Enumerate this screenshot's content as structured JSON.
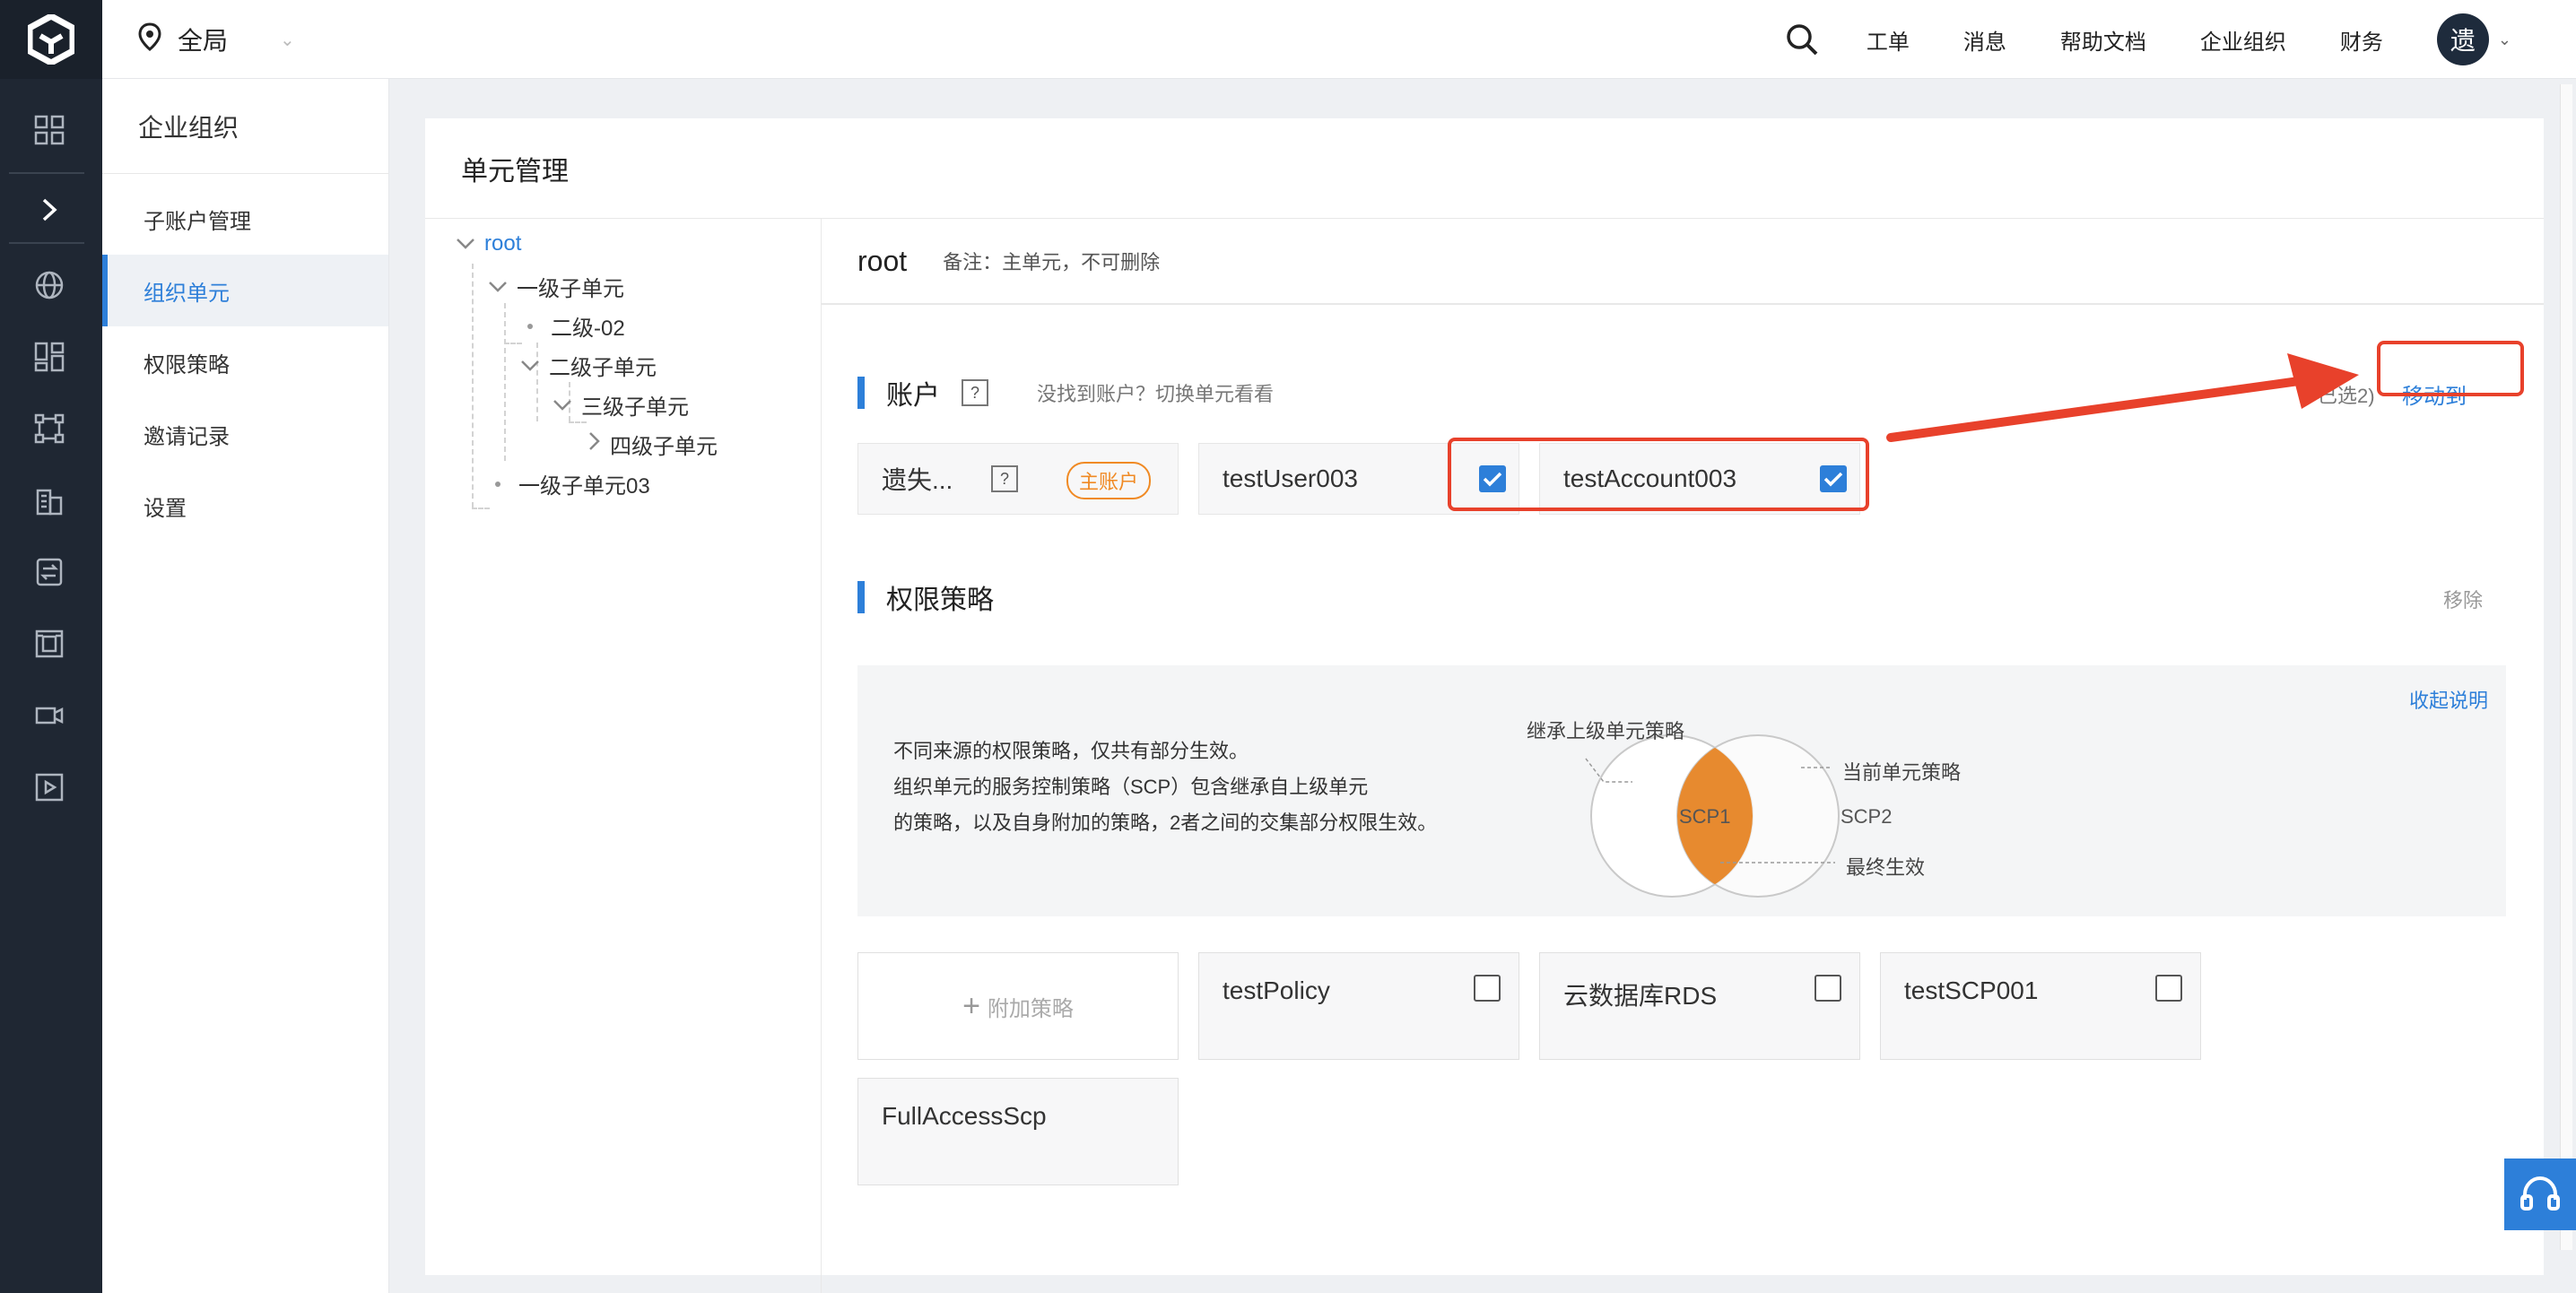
{
  "topbar": {
    "region": "全局",
    "nav": [
      "工单",
      "消息",
      "帮助文档",
      "企业组织",
      "财务"
    ],
    "avatar": "遗"
  },
  "subnav": {
    "title": "企业组织",
    "items": [
      {
        "label": "子账户管理",
        "active": false
      },
      {
        "label": "组织单元",
        "active": true
      },
      {
        "label": "权限策略",
        "active": false
      },
      {
        "label": "邀请记录",
        "active": false
      },
      {
        "label": "设置",
        "active": false
      }
    ]
  },
  "page": {
    "title": "单元管理"
  },
  "tree": {
    "root": "root",
    "l1a": "一级子单元",
    "l2a": "二级-02",
    "l2b": "二级子单元",
    "l3a": "三级子单元",
    "l4a": "四级子单元",
    "l1b": "一级子单元03"
  },
  "unit": {
    "name": "root",
    "note": "备注：主单元，不可删除"
  },
  "accounts": {
    "section_label": "账户",
    "help": "?",
    "hint": "没找到账户？切换单元看看",
    "selected_text": "已选2)",
    "move_to": "移动到",
    "items": [
      {
        "name": "遗失...",
        "badge": "主账户",
        "help": "?"
      },
      {
        "name": "testUser003",
        "checked": true
      },
      {
        "name": "testAccount003",
        "checked": true
      }
    ]
  },
  "policies": {
    "section_label": "权限策略",
    "remove": "移除",
    "collapse": "收起说明",
    "explain_lines": [
      "不同来源的权限策略，仅共有部分生效。",
      "组织单元的服务控制策略（SCP）包含继承自上级单元",
      "的策略，以及自身附加的策略，2者之间的交集部分权限生效。"
    ],
    "venn": {
      "inherited": "继承上级单元策略",
      "current": "当前单元策略",
      "final": "最终生效",
      "scp1": "SCP1",
      "scp2": "SCP2",
      "intersect_color": "#e78a2f"
    },
    "add_label": "附加策略",
    "cards": [
      {
        "name": "testPolicy"
      },
      {
        "name": "云数据库RDS"
      },
      {
        "name": "testSCP001"
      },
      {
        "name": "FullAccessScp"
      }
    ]
  },
  "colors": {
    "accent": "#2d7fd9",
    "annotation": "#e8412b",
    "badge": "#f08a24",
    "rail": "#1f2733"
  }
}
